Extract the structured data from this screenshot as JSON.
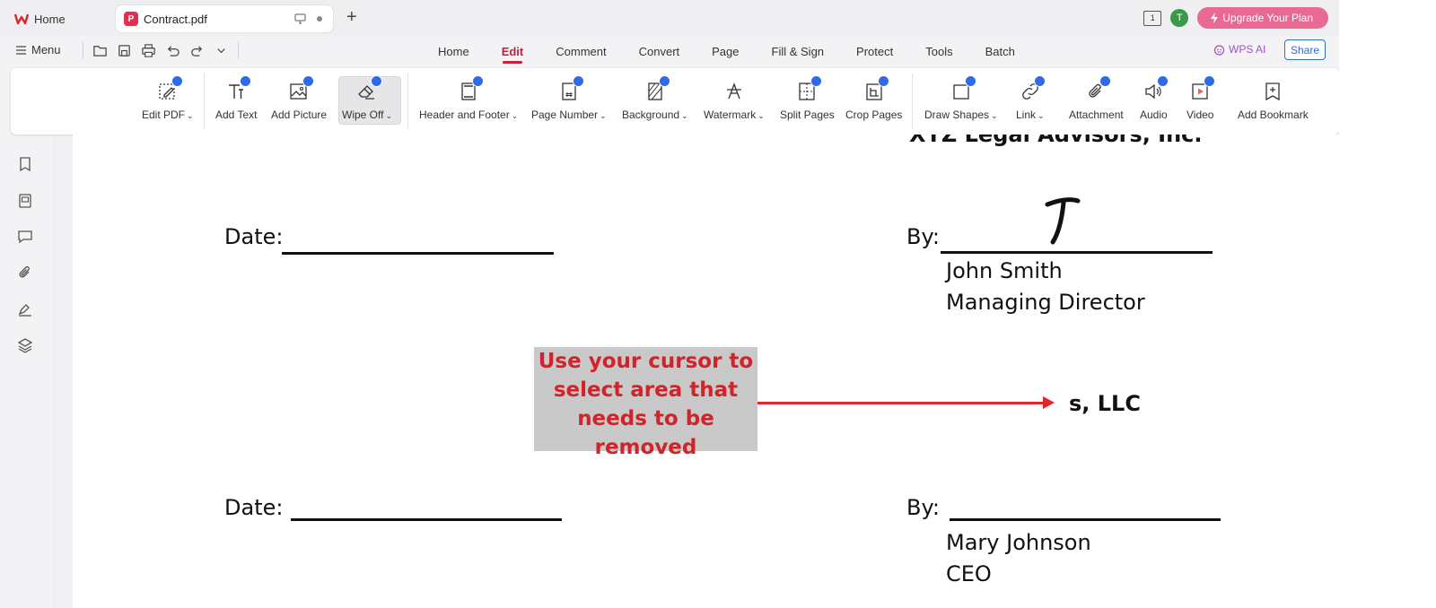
{
  "tabs": {
    "home_label": "Home",
    "doc_label": "Contract.pdf",
    "doc_badge": "P"
  },
  "top_right": {
    "page_indicator": "1",
    "avatar_initial": "T",
    "upgrade_label": "Upgrade Your Plan"
  },
  "menubar": {
    "menu_label": "Menu",
    "nav": [
      "Home",
      "Edit",
      "Comment",
      "Convert",
      "Page",
      "Fill & Sign",
      "Protect",
      "Tools",
      "Batch"
    ],
    "active_nav": "Edit",
    "wps_ai_label": "WPS AI",
    "share_label": "Share"
  },
  "ribbon": {
    "tools": [
      {
        "label": "Edit PDF",
        "icon": "edit-pdf-icon",
        "dropdown": true
      },
      {
        "label": "Add Text",
        "icon": "add-text-icon",
        "dropdown": false
      },
      {
        "label": "Add Picture",
        "icon": "add-picture-icon",
        "dropdown": false
      },
      {
        "label": "Wipe Off",
        "icon": "eraser-icon",
        "dropdown": true,
        "selected": true
      },
      {
        "label": "Header and Footer",
        "icon": "header-footer-icon",
        "dropdown": true
      },
      {
        "label": "Page Number",
        "icon": "page-number-icon",
        "dropdown": true
      },
      {
        "label": "Background",
        "icon": "background-icon",
        "dropdown": true
      },
      {
        "label": "Watermark",
        "icon": "watermark-icon",
        "dropdown": true
      },
      {
        "label": "Split Pages",
        "icon": "split-pages-icon",
        "dropdown": false
      },
      {
        "label": "Crop Pages",
        "icon": "crop-pages-icon",
        "dropdown": false
      },
      {
        "label": "Draw Shapes",
        "icon": "draw-shapes-icon",
        "dropdown": true
      },
      {
        "label": "Link",
        "icon": "link-icon",
        "dropdown": true
      },
      {
        "label": "Attachment",
        "icon": "attachment-icon",
        "dropdown": false
      },
      {
        "label": "Audio",
        "icon": "audio-icon",
        "dropdown": false
      },
      {
        "label": "Video",
        "icon": "video-icon",
        "dropdown": false
      },
      {
        "label": "Add Bookmark",
        "icon": "add-bookmark-icon",
        "dropdown": false
      }
    ]
  },
  "left_panel": [
    "bookmark-icon",
    "thumbnail-icon",
    "comment-icon",
    "attachment-icon",
    "signature-icon",
    "layers-icon"
  ],
  "document": {
    "header_fragment": "XYZ Legal Advisors, Inc.",
    "date_label_1": "Date:",
    "by_label_1": "By:",
    "signer_1_name": "John Smith",
    "signer_1_title": "Managing Director",
    "company_fragment": "s, LLC",
    "date_label_2": "Date:",
    "by_label_2": "By:",
    "signer_2_name": "Mary Johnson",
    "signer_2_title": "CEO"
  },
  "callout": {
    "text": "Use your cursor to select area that needs to be removed"
  },
  "colors": {
    "accent": "#c6213b",
    "upgrade": "#e86a92",
    "share": "#2b6fd6",
    "callout_text": "#d1232a",
    "callout_bg": "#c9c9c9",
    "arrow": "#e0252b"
  }
}
